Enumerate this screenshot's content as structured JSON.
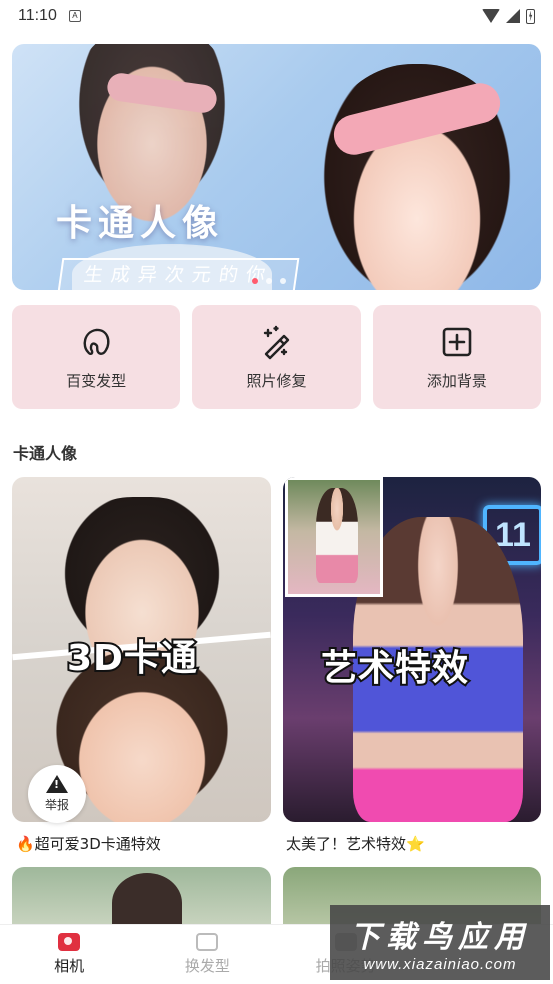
{
  "status_bar": {
    "time": "11:10",
    "notification_icon": "A"
  },
  "banner": {
    "title": "卡通人像",
    "subtitle": "生成异次元的你",
    "pages": 4,
    "active_page": 1
  },
  "tools": [
    {
      "label": "百变发型",
      "icon": "hair-icon"
    },
    {
      "label": "照片修复",
      "icon": "magic-wand-icon"
    },
    {
      "label": "添加背景",
      "icon": "plus-square-icon"
    }
  ],
  "section": {
    "title": "卡通人像"
  },
  "cards": [
    {
      "overlay": "3D卡通",
      "caption": "🔥超可爱3D卡通特效",
      "badge": "举报"
    },
    {
      "overlay": "艺术特效",
      "caption": "太美了！艺术特效⭐",
      "sign": "11"
    }
  ],
  "nav": [
    {
      "label": "相机",
      "active": true,
      "icon": "camera-icon"
    },
    {
      "label": "换发型",
      "active": false,
      "icon": "camera-outline-icon"
    },
    {
      "label": "拍照姿势",
      "active": false,
      "icon": "image-icon"
    }
  ],
  "watermark": {
    "line1": "下载鸟应用",
    "line2": "www.xiazainiao.com"
  },
  "colors": {
    "tool_bg": "#f6dfe3",
    "accent": "#e03040"
  }
}
